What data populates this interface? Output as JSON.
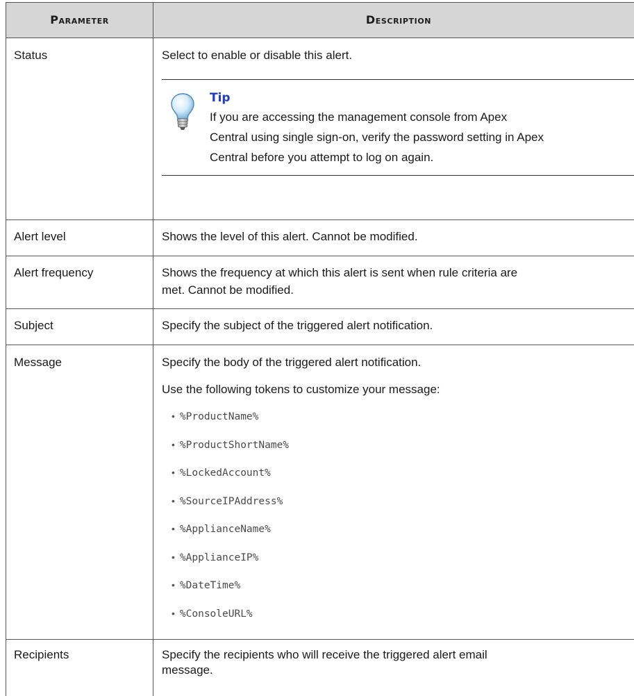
{
  "table": {
    "header": {
      "parameter": "Parameter",
      "description": "Description"
    },
    "rows": {
      "status": {
        "parameter": "Status",
        "description": "Select to enable or disable this alert.",
        "tip": {
          "title": "Tip",
          "lines": [
            "If you are accessing the management console from Apex",
            "Central using single sign-on, verify the password setting in Apex",
            "Central before you attempt to log on again."
          ],
          "icon": "lightbulb-icon"
        }
      },
      "alert_level": {
        "parameter": "Alert level",
        "description": "Shows the level of this alert. Cannot be modified."
      },
      "alert_frequency": {
        "parameter": "Alert frequency",
        "lines": [
          "Shows the frequency at which this alert is sent when rule criteria are",
          "met. Cannot be modified."
        ]
      },
      "subject": {
        "parameter": "Subject",
        "description": "Specify the subject of the triggered alert notification."
      },
      "message": {
        "parameter": "Message",
        "description": "Specify the body of the triggered alert notification.",
        "intro": "Use the following tokens to customize your message:",
        "tokens": [
          "%ProductName%",
          "%ProductShortName%",
          "%LockedAccount%",
          "%SourceIPAddress%",
          "%ApplianceName%",
          "%ApplianceIP%",
          "%DateTime%",
          "%ConsoleURL%"
        ]
      },
      "recipients": {
        "parameter": "Recipients",
        "lines": [
          "Specify the recipients who will receive the triggered alert email",
          "message."
        ]
      }
    },
    "bullet": "•",
    "colors": {
      "header_bg": "#d6d6d6",
      "tip_title": "#1f3ec8",
      "border": "#555555"
    }
  }
}
